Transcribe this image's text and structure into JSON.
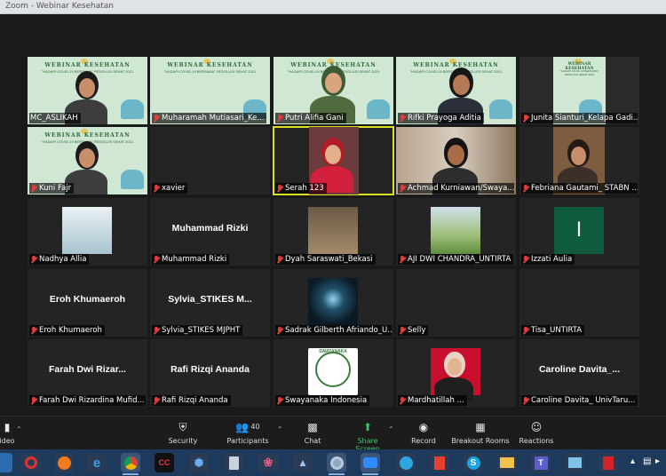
{
  "window": {
    "title": "Zoom - Webinar Kesehatan"
  },
  "poster": {
    "title": "WEBINAR KESEHATAN",
    "subtitle": "\"HADAPI COVID-19 BERSAMA\" RESOLUSI SEHAT 2021"
  },
  "participants": [
    {
      "name": "MC_ASLIKAH",
      "muted": false,
      "type": "poster-person"
    },
    {
      "name": "Muharamah Mutiasari_Ke...",
      "muted": true,
      "type": "poster"
    },
    {
      "name": "Putri Alifia Gani",
      "muted": true,
      "type": "poster-hijab"
    },
    {
      "name": "Rifki Prayoga Aditia",
      "muted": true,
      "type": "poster-man"
    },
    {
      "name": "Junita Sianturi_Kelapa Gadi...",
      "muted": true,
      "type": "poster-small"
    },
    {
      "name": "Kuni Fajr",
      "muted": true,
      "type": "poster-person"
    },
    {
      "name": "xavier",
      "muted": true,
      "type": "blank"
    },
    {
      "name": "Serah 123",
      "muted": true,
      "type": "video-red",
      "active": true
    },
    {
      "name": "Achmad Kurniawan/Swaya...",
      "muted": true,
      "type": "video-room"
    },
    {
      "name": "Febriana Gautami_ STABN ...",
      "muted": true,
      "type": "video-woman"
    },
    {
      "name": "Nadhya Allia",
      "muted": true,
      "type": "photo-vet"
    },
    {
      "name": "Muhammad Rizki",
      "muted": true,
      "type": "text",
      "display": "Muhammad Rizki"
    },
    {
      "name": "Dyah Saraswati_Bekasi",
      "muted": true,
      "type": "photo-hijab"
    },
    {
      "name": "AJI DWI CHANDRA_UNTIRTA",
      "muted": true,
      "type": "photo-field"
    },
    {
      "name": "Izzati Aulia",
      "muted": true,
      "type": "letter",
      "letter": "I"
    },
    {
      "name": "Eroh Khumaeroh",
      "muted": true,
      "type": "text",
      "display": "Eroh Khumaeroh"
    },
    {
      "name": "Sylvia_STIKES MJPHT",
      "muted": true,
      "type": "text",
      "display": "Sylvia_STIKES M..."
    },
    {
      "name": "Sadrak Gilberth Afriando_U...",
      "muted": true,
      "type": "photo-corridor"
    },
    {
      "name": "Selly",
      "muted": true,
      "type": "blank"
    },
    {
      "name": "Tisa_UNTIRTA",
      "muted": true,
      "type": "blank"
    },
    {
      "name": "Farah Dwi Rizardina Mufid...",
      "muted": true,
      "type": "text",
      "display": "Farah Dwi Rizar..."
    },
    {
      "name": "Rafi Rizqi Ananda",
      "muted": true,
      "type": "text",
      "display": "Rafi Rizqi Ananda"
    },
    {
      "name": "Swayanaka Indonesia",
      "muted": true,
      "type": "photo-logo",
      "logo_text": "SWAYANAKA"
    },
    {
      "name": "Mardhatillah ...",
      "muted": true,
      "type": "photo-red-hijab"
    },
    {
      "name": "Caroline Davita_ UnivTaru...",
      "muted": true,
      "type": "text",
      "display": "Caroline Davita_..."
    }
  ],
  "toolbar": {
    "video_label": "ideo",
    "security_label": "Security",
    "participants_label": "Participants",
    "participants_count": "40",
    "chat_label": "Chat",
    "share_label": "Share Screen",
    "record_label": "Record",
    "breakout_label": "Breakout Rooms",
    "reactions_label": "Reactions"
  },
  "colors": {
    "active_speaker": "#d9e021",
    "share_green": "#3cc36b",
    "muted_red": "#e23b3b"
  }
}
